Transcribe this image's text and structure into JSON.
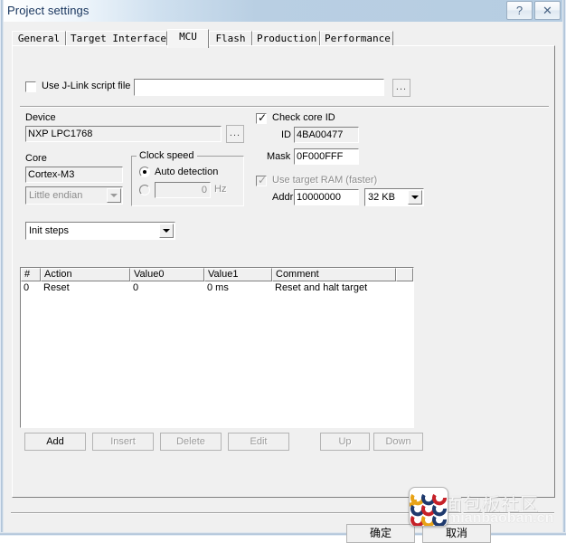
{
  "window": {
    "title": "Project settings",
    "help_glyph": "?",
    "close_glyph": "✕"
  },
  "tabs": [
    {
      "label": "General",
      "active": false
    },
    {
      "label": "Target Interface",
      "active": false
    },
    {
      "label": "MCU",
      "active": true
    },
    {
      "label": "Flash",
      "active": false
    },
    {
      "label": "Production",
      "active": false
    },
    {
      "label": "Performance",
      "active": false
    }
  ],
  "mcu": {
    "script_file": {
      "checkbox_label": "Use J-Link script file",
      "checked": false,
      "value": "",
      "browse_label": "..."
    },
    "device": {
      "label": "Device",
      "value": "NXP LPC1768",
      "browse_label": "..."
    },
    "core": {
      "label": "Core",
      "value": "Cortex-M3",
      "endian_value": "Little endian"
    },
    "clock_speed": {
      "group_label": "Clock speed",
      "auto_label": "Auto detection",
      "auto_selected": true,
      "manual_selected": false,
      "manual_value": "0",
      "unit_label": "Hz"
    },
    "check_core_id": {
      "checkbox_label": "Check core ID",
      "checked": true,
      "id_label": "ID",
      "id_value": "4BA00477",
      "mask_label": "Mask",
      "mask_value": "0F000FFF"
    },
    "target_ram": {
      "checkbox_label": "Use target RAM (faster)",
      "checked": true,
      "enabled": false,
      "addr_label": "Addr",
      "addr_value": "10000000",
      "size_value": "32 KB"
    },
    "steps_selector": {
      "value": "Init steps"
    },
    "steps_table": {
      "columns": [
        "#",
        "Action",
        "Value0",
        "Value1",
        "Comment",
        ""
      ],
      "rows": [
        {
          "num": "0",
          "action": "Reset",
          "value0": "0",
          "value1": "0 ms",
          "comment": "Reset and halt target"
        }
      ]
    },
    "step_buttons": [
      {
        "label": "Add",
        "enabled": true
      },
      {
        "label": "Insert",
        "enabled": false
      },
      {
        "label": "Delete",
        "enabled": false
      },
      {
        "label": "Edit",
        "enabled": false
      },
      {
        "label": "Up",
        "enabled": false
      },
      {
        "label": "Down",
        "enabled": false
      }
    ]
  },
  "dialog_buttons": {
    "ok_label": "确定",
    "cancel_label": "取消"
  },
  "watermark": {
    "line1": "面包板社区",
    "line2": "mianbaoban.cn"
  }
}
